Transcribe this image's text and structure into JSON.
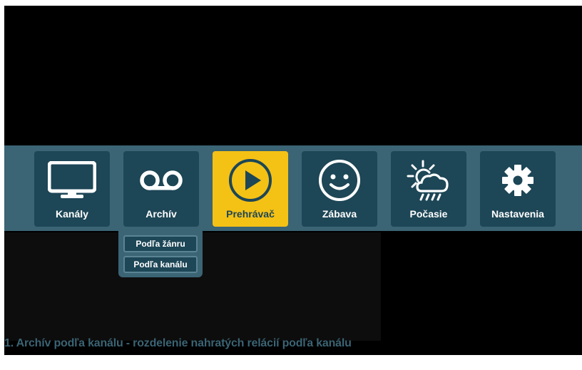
{
  "menu": {
    "items": [
      {
        "label": "Kanály",
        "icon": "tv-icon",
        "active": false
      },
      {
        "label": "Archív",
        "icon": "recording-icon",
        "active": false
      },
      {
        "label": "Prehrávač",
        "icon": "play-icon",
        "active": true
      },
      {
        "label": "Zábava",
        "icon": "smiley-icon",
        "active": false
      },
      {
        "label": "Počasie",
        "icon": "weather-icon",
        "active": false
      },
      {
        "label": "Nastavenia",
        "icon": "gear-icon",
        "active": false
      }
    ]
  },
  "submenu": {
    "items": [
      {
        "label": "Podľa žánru"
      },
      {
        "label": "Podľa kanálu"
      }
    ]
  },
  "caption": "1. Archív podľa kanálu - rozdelenie nahratých relácií podľa kanálu",
  "colors": {
    "menu_bar": "#3b6474",
    "tile": "#1d4656",
    "active_tile": "#f4c115",
    "caption": "#3b6474"
  }
}
